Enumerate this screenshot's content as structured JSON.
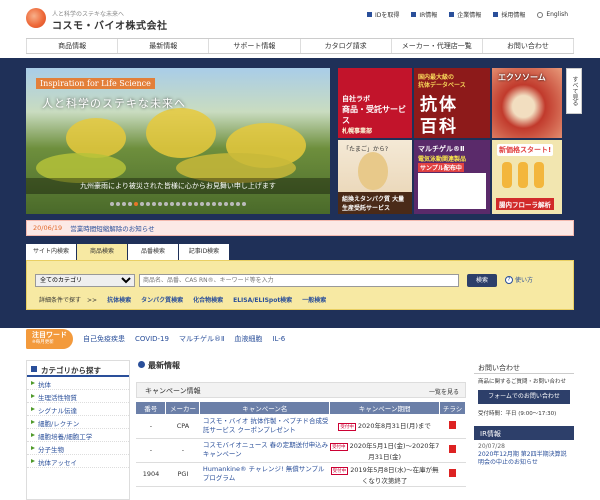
{
  "header": {
    "tagline": "人と科学のステキな未来へ",
    "company": "コスモ・バイオ株式会社",
    "top_links": [
      "IDを取得",
      "IR情報",
      "企業情報",
      "採用情報",
      "English"
    ]
  },
  "nav": [
    "商品情報",
    "最新情報",
    "サポート情報",
    "カタログ請求",
    "メーカー・代理店一覧",
    "お問い合わせ"
  ],
  "banner": {
    "inspiration": "Inspiration for Life Science",
    "tagline": "人と科学のステキな未来へ",
    "caption": "九州豪雨により被災された皆様に心からお見舞い申し上げます"
  },
  "tiles": {
    "t1_a": "自社ラボ",
    "t1_b": "商品・受託サービス",
    "t1_c": "札幌事業部",
    "t2_a": "国内最大級の",
    "t2_b": "抗体データベース",
    "t2_c": "抗体",
    "t2_d": "百科",
    "t3": "エクソソーム",
    "t4_a": "「たまご」から?",
    "t4_b": "組換えタンパク質 大量生産受託サービス",
    "t5_a": "マルチゲル®Ⅱ",
    "t5_b": "電気泳動関連製品",
    "t5_c": "サンプル配布中",
    "t6_a": "新価格スタート!",
    "t6_b": "腸内フローラ解析"
  },
  "side_tab": "すべて見る",
  "notice": {
    "date": "20/06/19",
    "text": "営業時間短縮解除のお知らせ"
  },
  "search": {
    "tabs": [
      "サイト内検索",
      "商品検索",
      "品番検索",
      "記事ID検索"
    ],
    "active_tab": 1,
    "category": "全てのカテゴリ",
    "placeholder": "商品名、品番、CAS RN®、キーワード等を入力",
    "button": "検索",
    "howto": "使い方",
    "detail_label": "詳細条件で探す　>>",
    "detail_links": [
      "抗体検索",
      "タンパク質検索",
      "化合物検索",
      "ELISA/ELISpot検索",
      "一般検索"
    ]
  },
  "hot_words": {
    "label": "注目ワード",
    "sub": "※毎月更新",
    "words": [
      "自己免疫疾患",
      "COVID-19",
      "マルチゲル®Ⅱ",
      "血液細胞",
      "IL-6"
    ]
  },
  "categories": {
    "title": "カテゴリから探す",
    "items": [
      "抗体",
      "生理活性物質",
      "シグナル伝達",
      "細胞/レクチン",
      "細胞培養/細胞工学",
      "分子生物",
      "抗体アッセイ"
    ]
  },
  "news": {
    "title": "最新情報",
    "campaign_title": "キャンペーン情報",
    "more": "一覧を見る",
    "columns": [
      "番号",
      "メーカー",
      "キャンペーン名",
      "キャンペーン期間",
      "チラシ"
    ],
    "rows": [
      {
        "no": "-",
        "maker": "CPA",
        "name": "コスモ・バイオ 抗体作製・ペプチド合成受託サービス クーポンプレゼント",
        "period": "2020年8月31日(月)まで"
      },
      {
        "no": "-",
        "maker": "-",
        "name": "コスモバイオニュース 春の定期送付申込みキャンペーン",
        "period": "2020年5月1日(金)～2020年7月31日(金)"
      },
      {
        "no": "1904",
        "maker": "PGI",
        "name": "Humankine® チャレンジ! 無償サンプルプログラム",
        "period": "2019年5月8日(水)～在庫が無くなり次第終了"
      }
    ],
    "tag": "受付中"
  },
  "inquiry": {
    "title": "お問い合わせ",
    "text": "商品に関するご質問・お問い合わせ",
    "button": "フォームでのお問い合わせ",
    "hours": "受付時間：平日 (9:00～17:30)"
  },
  "ir": {
    "title": "IR情報",
    "date": "20/07/28",
    "text": "2020年12月期 第2四半期決算説明会の中止のお知らせ"
  }
}
